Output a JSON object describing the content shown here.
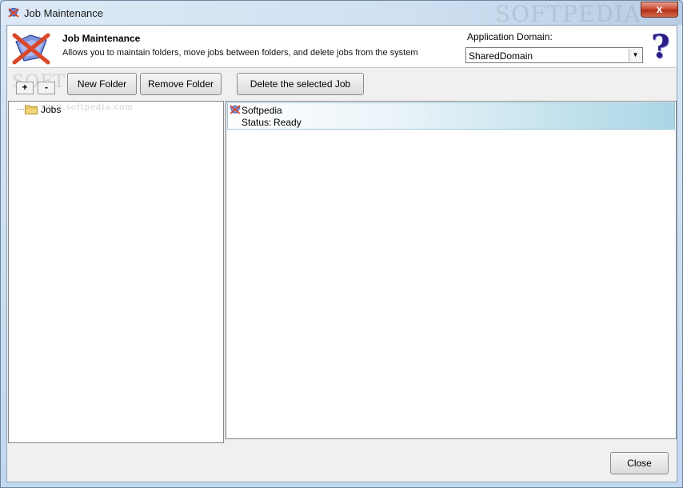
{
  "window": {
    "title": "Job Maintenance",
    "close_glyph": "x",
    "icon": "job-maintenance-app-icon"
  },
  "header": {
    "title": "Job Maintenance",
    "description": "Allows you to maintain folders, move jobs between folders, and delete jobs from the system",
    "domain_label": "Application Domain:",
    "domain_value": "SharedDomain",
    "help_glyph": "?"
  },
  "toolbar": {
    "expand_label": "+",
    "collapse_label": "-",
    "new_folder_label": "New Folder",
    "remove_folder_label": "Remove Folder",
    "delete_job_label": "Delete the selected Job"
  },
  "tree": {
    "items": [
      {
        "label": "Jobs",
        "icon": "folder-icon"
      }
    ]
  },
  "jobs": {
    "items": [
      {
        "name": "Softpedia",
        "status_label": "Status:",
        "status": "Ready"
      }
    ]
  },
  "footer": {
    "close_label": "Close"
  },
  "watermarks": {
    "title": "SOFTPEDIA",
    "toolbar": "SOFTPEDIA",
    "tree": "www.softpedia.com"
  }
}
